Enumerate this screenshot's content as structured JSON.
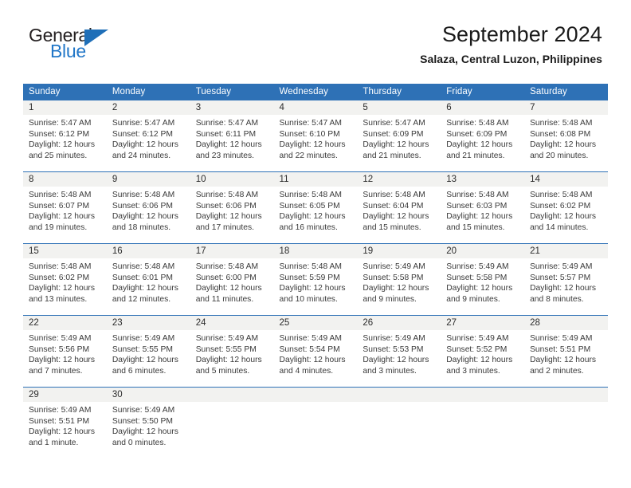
{
  "logo": {
    "word_top": "General",
    "word_bottom": "Blue",
    "triangle_icon": "blue-triangle-icon",
    "color_dark": "#231f20",
    "color_blue": "#2277c8"
  },
  "header": {
    "title": "September 2024",
    "subtitle": "Salaza, Central Luzon, Philippines"
  },
  "theme": {
    "header_blue": "#2e71b6",
    "daynum_band": "#f2f2f0",
    "text": "#3a3a3a"
  },
  "calendar": {
    "weekday_headers": [
      "Sunday",
      "Monday",
      "Tuesday",
      "Wednesday",
      "Thursday",
      "Friday",
      "Saturday"
    ],
    "weeks": [
      [
        {
          "day": "1",
          "sunrise": "Sunrise: 5:47 AM",
          "sunset": "Sunset: 6:12 PM",
          "daylight_1": "Daylight: 12 hours",
          "daylight_2": "and 25 minutes."
        },
        {
          "day": "2",
          "sunrise": "Sunrise: 5:47 AM",
          "sunset": "Sunset: 6:12 PM",
          "daylight_1": "Daylight: 12 hours",
          "daylight_2": "and 24 minutes."
        },
        {
          "day": "3",
          "sunrise": "Sunrise: 5:47 AM",
          "sunset": "Sunset: 6:11 PM",
          "daylight_1": "Daylight: 12 hours",
          "daylight_2": "and 23 minutes."
        },
        {
          "day": "4",
          "sunrise": "Sunrise: 5:47 AM",
          "sunset": "Sunset: 6:10 PM",
          "daylight_1": "Daylight: 12 hours",
          "daylight_2": "and 22 minutes."
        },
        {
          "day": "5",
          "sunrise": "Sunrise: 5:47 AM",
          "sunset": "Sunset: 6:09 PM",
          "daylight_1": "Daylight: 12 hours",
          "daylight_2": "and 21 minutes."
        },
        {
          "day": "6",
          "sunrise": "Sunrise: 5:48 AM",
          "sunset": "Sunset: 6:09 PM",
          "daylight_1": "Daylight: 12 hours",
          "daylight_2": "and 21 minutes."
        },
        {
          "day": "7",
          "sunrise": "Sunrise: 5:48 AM",
          "sunset": "Sunset: 6:08 PM",
          "daylight_1": "Daylight: 12 hours",
          "daylight_2": "and 20 minutes."
        }
      ],
      [
        {
          "day": "8",
          "sunrise": "Sunrise: 5:48 AM",
          "sunset": "Sunset: 6:07 PM",
          "daylight_1": "Daylight: 12 hours",
          "daylight_2": "and 19 minutes."
        },
        {
          "day": "9",
          "sunrise": "Sunrise: 5:48 AM",
          "sunset": "Sunset: 6:06 PM",
          "daylight_1": "Daylight: 12 hours",
          "daylight_2": "and 18 minutes."
        },
        {
          "day": "10",
          "sunrise": "Sunrise: 5:48 AM",
          "sunset": "Sunset: 6:06 PM",
          "daylight_1": "Daylight: 12 hours",
          "daylight_2": "and 17 minutes."
        },
        {
          "day": "11",
          "sunrise": "Sunrise: 5:48 AM",
          "sunset": "Sunset: 6:05 PM",
          "daylight_1": "Daylight: 12 hours",
          "daylight_2": "and 16 minutes."
        },
        {
          "day": "12",
          "sunrise": "Sunrise: 5:48 AM",
          "sunset": "Sunset: 6:04 PM",
          "daylight_1": "Daylight: 12 hours",
          "daylight_2": "and 15 minutes."
        },
        {
          "day": "13",
          "sunrise": "Sunrise: 5:48 AM",
          "sunset": "Sunset: 6:03 PM",
          "daylight_1": "Daylight: 12 hours",
          "daylight_2": "and 15 minutes."
        },
        {
          "day": "14",
          "sunrise": "Sunrise: 5:48 AM",
          "sunset": "Sunset: 6:02 PM",
          "daylight_1": "Daylight: 12 hours",
          "daylight_2": "and 14 minutes."
        }
      ],
      [
        {
          "day": "15",
          "sunrise": "Sunrise: 5:48 AM",
          "sunset": "Sunset: 6:02 PM",
          "daylight_1": "Daylight: 12 hours",
          "daylight_2": "and 13 minutes."
        },
        {
          "day": "16",
          "sunrise": "Sunrise: 5:48 AM",
          "sunset": "Sunset: 6:01 PM",
          "daylight_1": "Daylight: 12 hours",
          "daylight_2": "and 12 minutes."
        },
        {
          "day": "17",
          "sunrise": "Sunrise: 5:48 AM",
          "sunset": "Sunset: 6:00 PM",
          "daylight_1": "Daylight: 12 hours",
          "daylight_2": "and 11 minutes."
        },
        {
          "day": "18",
          "sunrise": "Sunrise: 5:48 AM",
          "sunset": "Sunset: 5:59 PM",
          "daylight_1": "Daylight: 12 hours",
          "daylight_2": "and 10 minutes."
        },
        {
          "day": "19",
          "sunrise": "Sunrise: 5:49 AM",
          "sunset": "Sunset: 5:58 PM",
          "daylight_1": "Daylight: 12 hours",
          "daylight_2": "and 9 minutes."
        },
        {
          "day": "20",
          "sunrise": "Sunrise: 5:49 AM",
          "sunset": "Sunset: 5:58 PM",
          "daylight_1": "Daylight: 12 hours",
          "daylight_2": "and 9 minutes."
        },
        {
          "day": "21",
          "sunrise": "Sunrise: 5:49 AM",
          "sunset": "Sunset: 5:57 PM",
          "daylight_1": "Daylight: 12 hours",
          "daylight_2": "and 8 minutes."
        }
      ],
      [
        {
          "day": "22",
          "sunrise": "Sunrise: 5:49 AM",
          "sunset": "Sunset: 5:56 PM",
          "daylight_1": "Daylight: 12 hours",
          "daylight_2": "and 7 minutes."
        },
        {
          "day": "23",
          "sunrise": "Sunrise: 5:49 AM",
          "sunset": "Sunset: 5:55 PM",
          "daylight_1": "Daylight: 12 hours",
          "daylight_2": "and 6 minutes."
        },
        {
          "day": "24",
          "sunrise": "Sunrise: 5:49 AM",
          "sunset": "Sunset: 5:55 PM",
          "daylight_1": "Daylight: 12 hours",
          "daylight_2": "and 5 minutes."
        },
        {
          "day": "25",
          "sunrise": "Sunrise: 5:49 AM",
          "sunset": "Sunset: 5:54 PM",
          "daylight_1": "Daylight: 12 hours",
          "daylight_2": "and 4 minutes."
        },
        {
          "day": "26",
          "sunrise": "Sunrise: 5:49 AM",
          "sunset": "Sunset: 5:53 PM",
          "daylight_1": "Daylight: 12 hours",
          "daylight_2": "and 3 minutes."
        },
        {
          "day": "27",
          "sunrise": "Sunrise: 5:49 AM",
          "sunset": "Sunset: 5:52 PM",
          "daylight_1": "Daylight: 12 hours",
          "daylight_2": "and 3 minutes."
        },
        {
          "day": "28",
          "sunrise": "Sunrise: 5:49 AM",
          "sunset": "Sunset: 5:51 PM",
          "daylight_1": "Daylight: 12 hours",
          "daylight_2": "and 2 minutes."
        }
      ],
      [
        {
          "day": "29",
          "sunrise": "Sunrise: 5:49 AM",
          "sunset": "Sunset: 5:51 PM",
          "daylight_1": "Daylight: 12 hours",
          "daylight_2": "and 1 minute."
        },
        {
          "day": "30",
          "sunrise": "Sunrise: 5:49 AM",
          "sunset": "Sunset: 5:50 PM",
          "daylight_1": "Daylight: 12 hours",
          "daylight_2": "and 0 minutes."
        },
        {
          "day": "",
          "sunrise": "",
          "sunset": "",
          "daylight_1": "",
          "daylight_2": ""
        },
        {
          "day": "",
          "sunrise": "",
          "sunset": "",
          "daylight_1": "",
          "daylight_2": ""
        },
        {
          "day": "",
          "sunrise": "",
          "sunset": "",
          "daylight_1": "",
          "daylight_2": ""
        },
        {
          "day": "",
          "sunrise": "",
          "sunset": "",
          "daylight_1": "",
          "daylight_2": ""
        },
        {
          "day": "",
          "sunrise": "",
          "sunset": "",
          "daylight_1": "",
          "daylight_2": ""
        }
      ]
    ]
  }
}
